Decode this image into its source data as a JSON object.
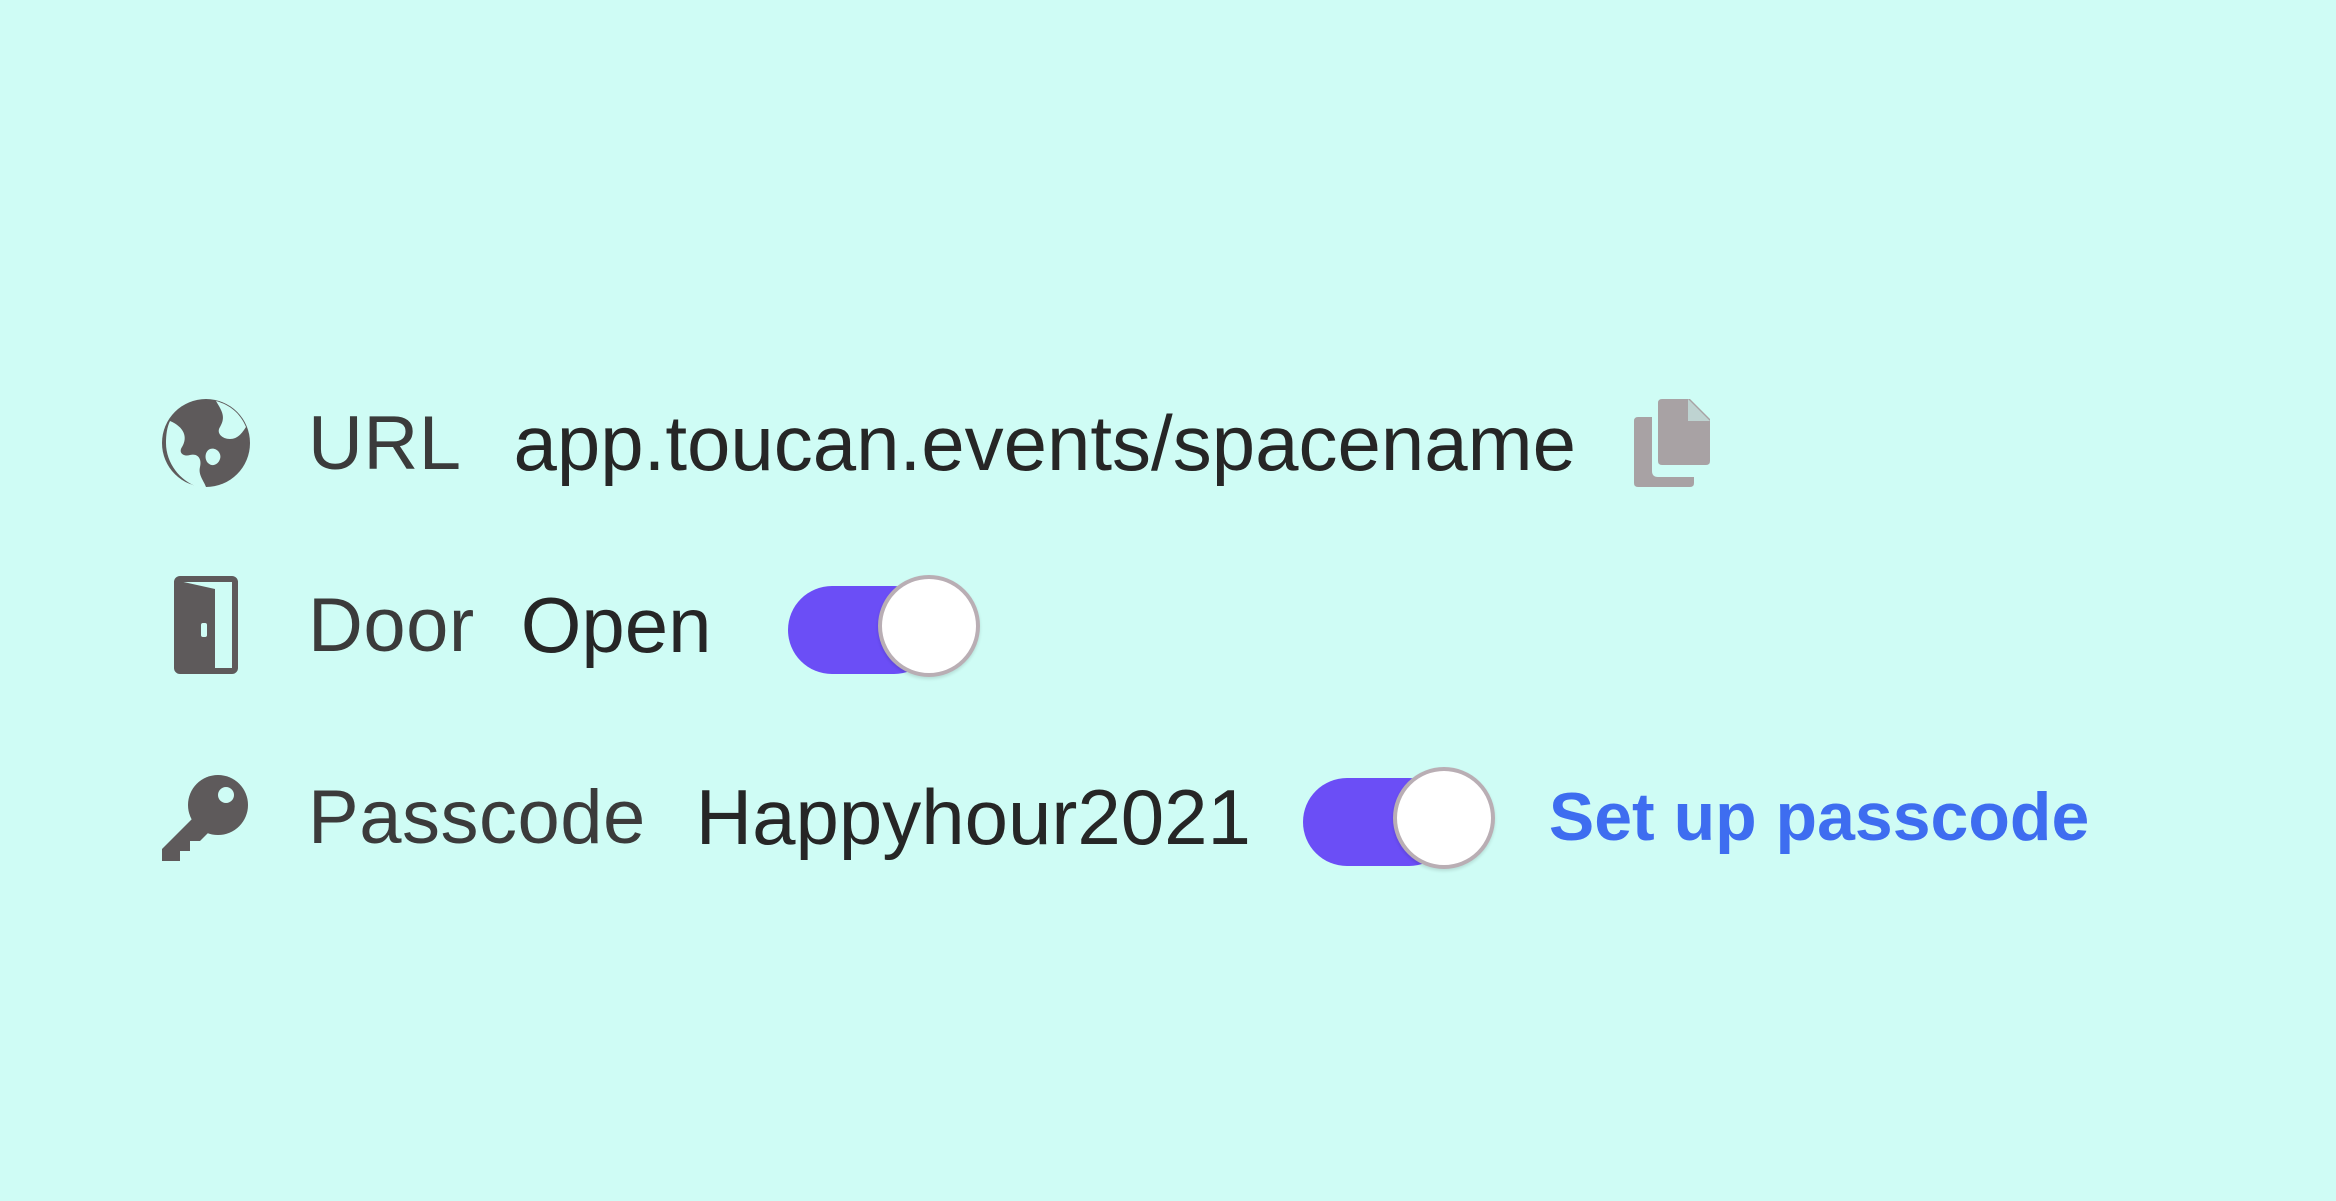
{
  "rows": {
    "url": {
      "icon": "globe-icon",
      "label": "URL",
      "value": "app.toucan.events/spacename",
      "action_icon": "copy-icon"
    },
    "door": {
      "icon": "door-icon",
      "label": "Door",
      "value": "Open",
      "toggle_on": true
    },
    "passcode": {
      "icon": "key-icon",
      "label": "Passcode",
      "value": "Happyhour2021",
      "toggle_on": true,
      "link_label": "Set up passcode"
    }
  },
  "colors": {
    "background": "#cffcf5",
    "icon": "#5e5a5b",
    "copy_icon": "#a8a2a4",
    "toggle_track": "#6b4ef6",
    "link": "#3e6df0"
  }
}
